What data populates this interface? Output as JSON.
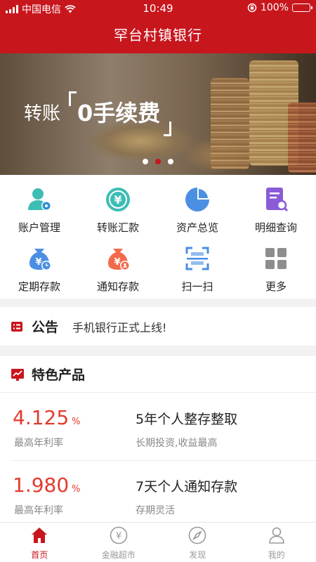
{
  "status_bar": {
    "carrier": "中国电信",
    "time": "10:49",
    "battery": "100%"
  },
  "header": {
    "title": "罕台村镇银行"
  },
  "banner": {
    "text_main": "转账",
    "text_highlight": "0手续费",
    "active_dot": 1,
    "dot_count": 3
  },
  "grid": {
    "items": [
      {
        "label": "账户管理",
        "icon": "account-icon"
      },
      {
        "label": "转账汇款",
        "icon": "transfer-icon"
      },
      {
        "label": "资产总览",
        "icon": "pie-chart-icon"
      },
      {
        "label": "明细查询",
        "icon": "detail-search-icon"
      },
      {
        "label": "定期存款",
        "icon": "fixed-deposit-icon"
      },
      {
        "label": "通知存款",
        "icon": "notice-deposit-icon"
      },
      {
        "label": "扫一扫",
        "icon": "scan-icon"
      },
      {
        "label": "更多",
        "icon": "more-grid-icon"
      }
    ]
  },
  "notice": {
    "label": "公告",
    "message": "手机银行正式上线!"
  },
  "products": {
    "title": "特色产品",
    "items": [
      {
        "rate": "4.125",
        "unit": "%",
        "rate_label": "最高年利率",
        "name": "5年个人整存整取",
        "desc": "长期投资,收益最高"
      },
      {
        "rate": "1.980",
        "unit": "%",
        "rate_label": "最高年利率",
        "name": "7天个人通知存款",
        "desc": "存期灵活"
      }
    ]
  },
  "tabbar": {
    "tabs": [
      {
        "label": "首页",
        "icon": "home-icon",
        "active": true
      },
      {
        "label": "金融超市",
        "icon": "yuan-circle-icon",
        "active": false
      },
      {
        "label": "发现",
        "icon": "compass-icon",
        "active": false
      },
      {
        "label": "我的",
        "icon": "user-icon",
        "active": false
      }
    ]
  },
  "colors": {
    "brand_red": "#c8161d",
    "rate_red": "#e23b2e"
  }
}
